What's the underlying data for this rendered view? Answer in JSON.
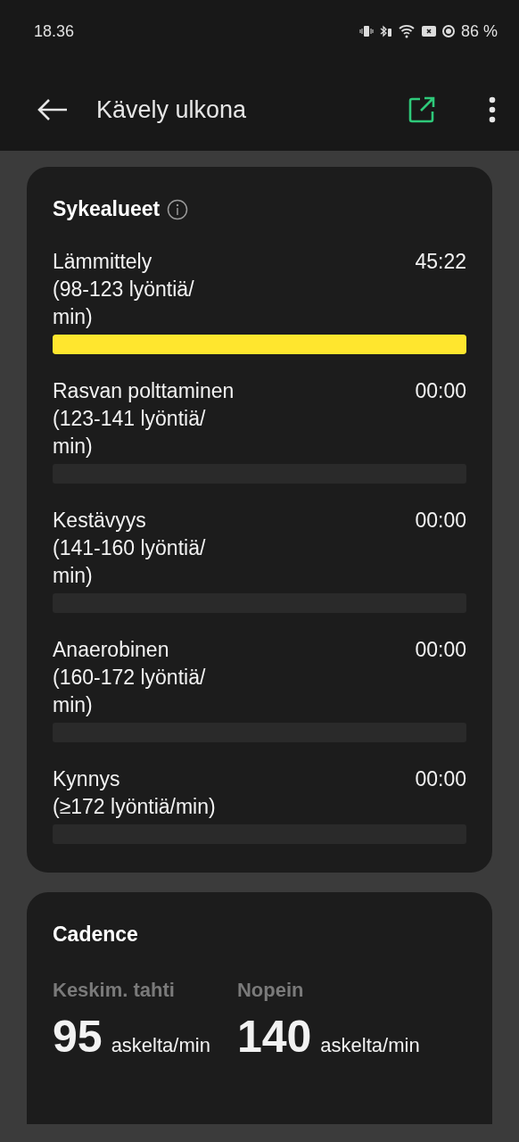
{
  "status_bar": {
    "time": "18.36",
    "battery": "86 %"
  },
  "app_bar": {
    "title": "Kävely ulkona"
  },
  "heart_zones": {
    "title": "Sykealueet",
    "zones": [
      {
        "name": "Lämmittely",
        "range": "(98-123 lyöntiä/min)",
        "time": "45:22",
        "level": 1
      },
      {
        "name": "Rasvan polttaminen",
        "range": "(123-141 lyöntiä/min)",
        "time": "00:00",
        "level": 0
      },
      {
        "name": "Kestävyys",
        "range": "(141-160 lyöntiä/min)",
        "time": "00:00",
        "level": 0
      },
      {
        "name": "Anaerobinen",
        "range": "(160-172 lyöntiä/min)",
        "time": "00:00",
        "level": 0
      },
      {
        "name": "Kynnys",
        "range": "(≥172 lyöntiä/min)",
        "time": "00:00",
        "level": 0
      }
    ]
  },
  "cadence": {
    "title": "Cadence",
    "stats": [
      {
        "label": "Keskim. tahti",
        "value": "95",
        "unit": "askelta/min"
      },
      {
        "label": "Nopein",
        "value": "140",
        "unit": "askelta/min"
      }
    ]
  }
}
